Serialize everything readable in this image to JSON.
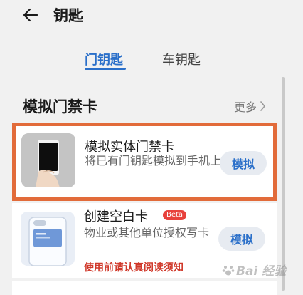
{
  "header": {
    "back_icon": "arrow-left-icon",
    "title": "钥匙"
  },
  "tabs": [
    {
      "label": "门钥匙",
      "active": true
    },
    {
      "label": "车钥匙",
      "active": false
    }
  ],
  "section": {
    "title": "模拟门禁卡",
    "more_label": "更多",
    "more_icon": "chevron-right-icon"
  },
  "items": [
    {
      "title": "模拟实体门禁卡",
      "description": "将已有门钥匙模拟到手机上",
      "button_label": "模拟",
      "image_icon": "phone-in-hand-icon",
      "highlighted": true,
      "highlight_color": "#e26b3a"
    },
    {
      "title": "创建空白卡",
      "badge": "Beta",
      "description": "物业或其他单位授权写卡",
      "warning": "使用前请认真阅读须知",
      "button_label": "模拟",
      "image_icon": "phone-card-icon"
    }
  ],
  "watermark": {
    "text": "Bai 经验",
    "icon": "paw-icon"
  },
  "colors": {
    "accent": "#2a6fc9",
    "highlight": "#e26b3a",
    "warning": "#d0392b",
    "beta": "#e8413c",
    "background": "#f1f1f1"
  }
}
